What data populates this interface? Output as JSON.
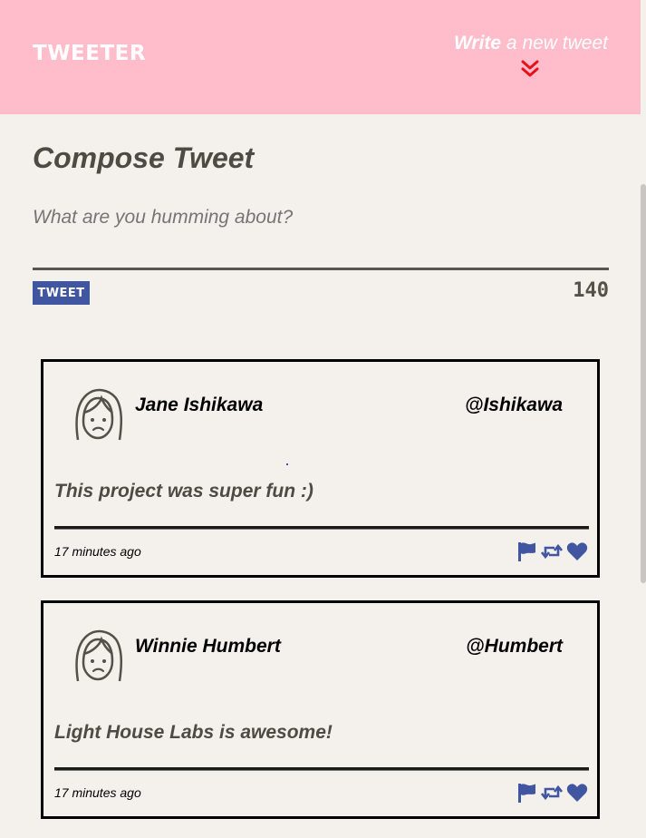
{
  "nav": {
    "brand": "TWEETER",
    "write_bold": "Write",
    "write_rest": " a new tweet",
    "chevron_icon": "double-chevron-down-icon",
    "chevron_color": "#e8101a",
    "background": "#ffbccb"
  },
  "compose": {
    "title": "Compose Tweet",
    "placeholder": "What are you humming about?",
    "button_label": "TWEET",
    "counter": "140",
    "button_color": "#4056a1"
  },
  "tweets": [
    {
      "name": "Jane Ishikawa",
      "handle": "@Ishikawa",
      "text": "This project was super fun :)",
      "time": "17 minutes ago",
      "avatar_icon": "user-avatar-icon"
    },
    {
      "name": "Winnie Humbert",
      "handle": "@Humbert",
      "text": "Light House Labs is awesome!",
      "time": "17 minutes ago",
      "avatar_icon": "user-avatar-icon"
    }
  ],
  "action_icons": [
    "flag-icon",
    "retweet-icon",
    "heart-icon"
  ],
  "action_color": "#4056a1"
}
